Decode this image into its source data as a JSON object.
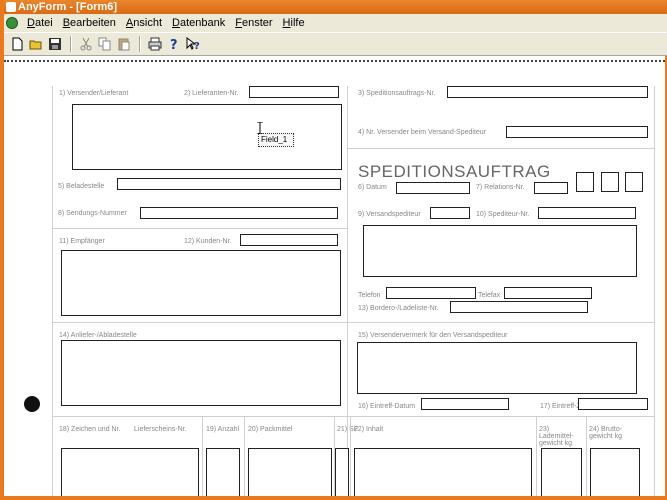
{
  "window": {
    "title": "AnyForm - [Form6]"
  },
  "menu": [
    "Datei",
    "Bearbeiten",
    "Ansicht",
    "Datenbank",
    "Fenster",
    "Hilfe"
  ],
  "form": {
    "title": "SPEDITIONSAUFTRAG",
    "field_label": "Field_1",
    "labels": {
      "l1": "1) Versender/Lieferant",
      "l2": "2) Lieferanten-Nr.",
      "l3": "3) Speditionsauftrags-Nr.",
      "l4": "4) Nr. Versender beim Versand-Spediteur",
      "l5": "5) Beladestelle",
      "l6": "6) Datum",
      "l7": "7) Relations-Nr.",
      "l8": "8) Sendungs-Nummer",
      "l9": "9) Versandspediteur",
      "l10": "10) Spediteur-Nr.",
      "l11": "11) Empfänger",
      "l12": "12) Kunden-Nr.",
      "l13a": "Telefon",
      "l13b": "Telefax",
      "l13": "13) Bordero-/Ladeliste-Nr.",
      "l14": "14) Anliefer-/Abladestelle",
      "l15": "15) Versendervermerk für den Versandspediteur",
      "l16": "16) Eintreff-Datum",
      "l17": "17) Eintreff-Zeit",
      "l18": "18) Zeichen und Nr.",
      "l18b": "Lieferscheins-Nr.",
      "l19": "19) Anzahl",
      "l20": "20) Packmittel",
      "l21": "21) SF",
      "l22": "22) Inhalt",
      "l23": "23) Lademittel-gewicht kg",
      "l24": "24) Brutto-gewicht kg"
    }
  }
}
